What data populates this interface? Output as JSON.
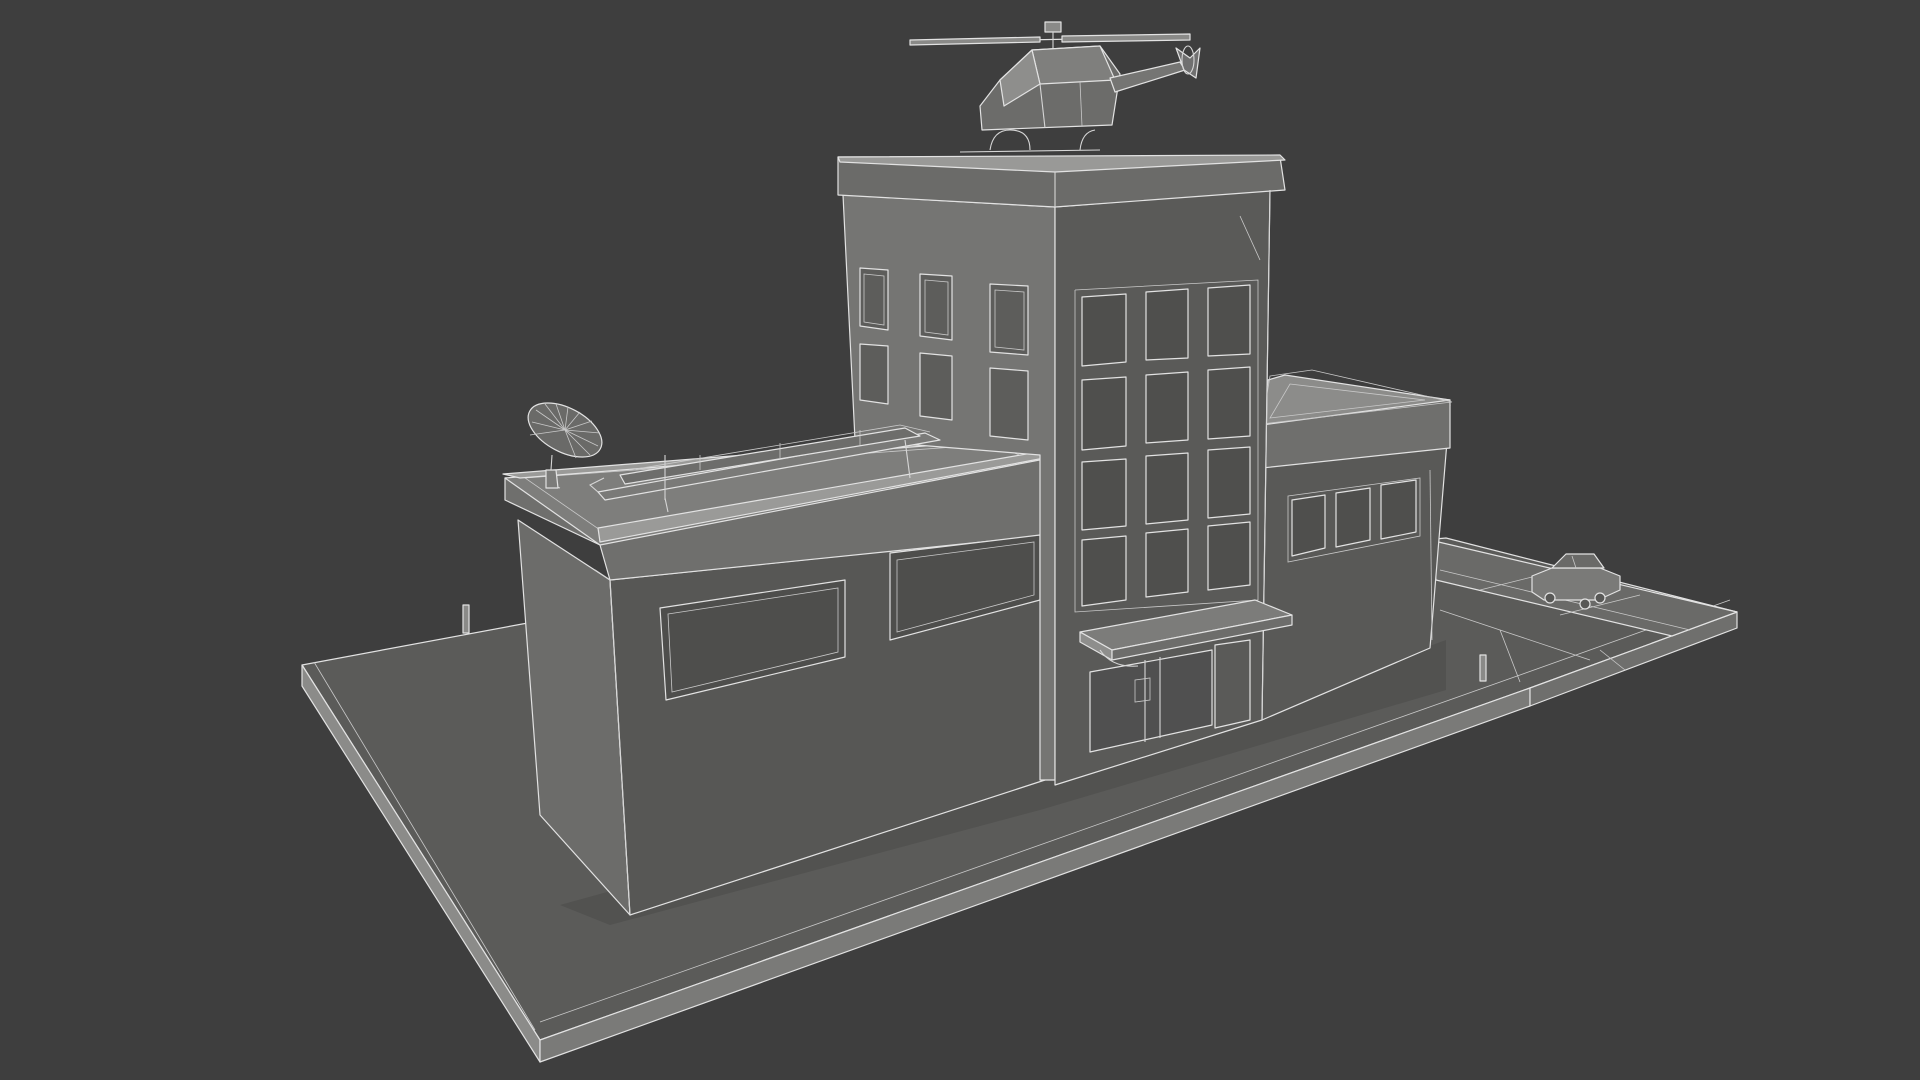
{
  "scene": {
    "background_color": "#3e3e3e",
    "render_style": "wireframe-over-clay",
    "surface_colors": {
      "ground_top": "#5d5d5b",
      "ground_side_light": "#8a8a88",
      "ground_side_dark": "#6e6e6c",
      "wall_front": "#575755",
      "wall_side": "#6d6d6b",
      "wall_lit": "#7b7b79",
      "roof_top": "#8d8d8b",
      "window_pane": "#4f4f4d",
      "edge_lines": "#d8d8d8"
    },
    "objects": [
      {
        "name": "ground-plate",
        "label": ""
      },
      {
        "name": "left-wing-building",
        "label": ""
      },
      {
        "name": "central-tower",
        "label": ""
      },
      {
        "name": "right-wing-building",
        "label": ""
      },
      {
        "name": "helicopter",
        "label": ""
      },
      {
        "name": "satellite-dish",
        "label": ""
      },
      {
        "name": "rooftop-solar-frame",
        "label": ""
      },
      {
        "name": "entrance-canopy",
        "label": ""
      },
      {
        "name": "parked-car",
        "label": ""
      },
      {
        "name": "bollards",
        "label": ""
      }
    ]
  }
}
